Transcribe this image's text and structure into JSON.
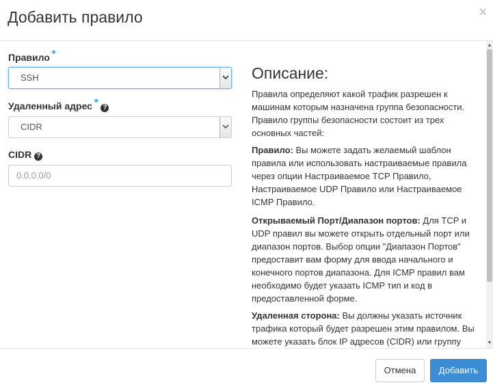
{
  "dialog": {
    "title": "Добавить правило",
    "close_glyph": "×"
  },
  "form": {
    "rule": {
      "label": "Правило",
      "required_mark": "*",
      "selected": "SSH"
    },
    "remote": {
      "label": "Удаленный адрес",
      "required_mark": "*",
      "help_glyph": "?",
      "selected": "CIDR"
    },
    "cidr": {
      "label": "CIDR",
      "help_glyph": "?",
      "placeholder": "0.0.0.0/0"
    }
  },
  "description": {
    "title": "Описание:",
    "intro": "Правила определяют какой трафик разрешен к машинам которым назначена группа безопасности. Правило группы безопасности состоит из трех основных частей:",
    "sections": [
      {
        "term": "Правило:",
        "text": " Вы можете задать желаемый шаблон правила или использовать настраиваемые правила через опции Настраиваемое TCP Правило, Настраиваемое UDP Правило или Настраиваемое ICMP Правило."
      },
      {
        "term": "Открываемый Порт/Диапазон портов:",
        "text": " Для TCP и UDP правил вы можете открыть отдельный порт или диапазон портов. Выбор опции \"Диапазон Портов\" предоставит вам форму для ввода начального и конечного портов диапазона. Для ICMP правил вам необходимо будет указать ICMP тип и код в предоставленной форме."
      },
      {
        "term": "Удаленная сторона:",
        "text": " Вы должны указать источник трафика который будет разрешен этим правилом. Вы можете указать блок IP адресов (CIDR) или группу"
      }
    ]
  },
  "footer": {
    "cancel_label": "Отмена",
    "add_label": "Добавить"
  },
  "colors": {
    "accent": "#3b8dd6",
    "required": "#0aa1e2",
    "focus": "#66afe9"
  }
}
